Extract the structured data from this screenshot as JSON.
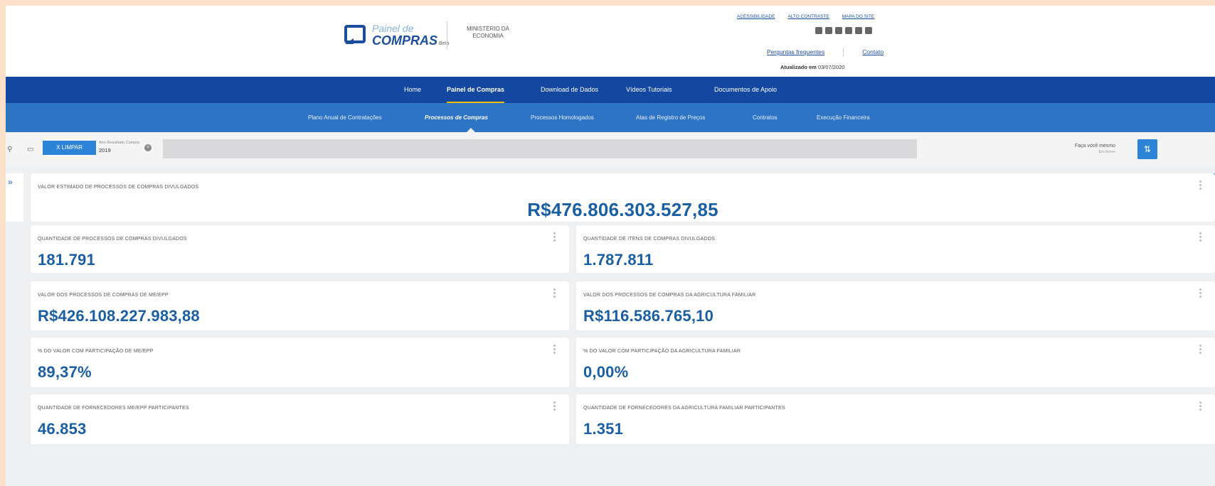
{
  "header": {
    "logo_line1": "Painel de",
    "logo_line2": "COMPRAS",
    "logo_beta": "Beta",
    "ministry_line1": "MINISTÉRIO DA",
    "ministry_line2": "ECONOMIA",
    "util_links": [
      "ACESSIBILIDADE",
      "ALTO CONTRASTE",
      "MAPA DO SITE"
    ],
    "social_icons": [
      "rss-icon",
      "flickr-icon",
      "twitter-icon",
      "facebook-icon",
      "linkedin-icon",
      "youtube-icon"
    ],
    "faq_link": "Perguntas frequentes",
    "contact_link": "Contato",
    "updated_label": "Atualizado em",
    "updated_date": "03/07/2020"
  },
  "main_nav": {
    "items": [
      "Home",
      "Painel de Compras",
      "Download de Dados",
      "Vídeos Tutoriais",
      "Documentos de Apoio"
    ],
    "active": "Painel de Compras"
  },
  "sub_nav": {
    "items": [
      "Plano Anual de Contratações",
      "Processos de Compras",
      "Processos Homologados",
      "Atas de Registro de Preços",
      "Contratos",
      "Execução Financeira"
    ],
    "active": "Processos de Compras"
  },
  "filter_bar": {
    "clear_label": "X  LIMPAR",
    "chip_label": "Ano Resultado Compra",
    "chip_value": "2019",
    "diy_label": "Faça você mesmo",
    "diy_sub": "Em breve"
  },
  "cards": {
    "hero": {
      "title": "VALOR ESTIMADO DE PROCESSOS DE COMPRAS DIVULGADOS",
      "value": "R$476.806.303.527,85"
    },
    "qtd_processos": {
      "title": "QUANTIDADE DE PROCESSOS DE COMPRAS DIVULGADOS",
      "value": "181.791"
    },
    "qtd_itens": {
      "title": "QUANTIDADE DE ITENS DE COMPRAS DIVULGADOS",
      "value": "1.787.811"
    },
    "valor_me_epp": {
      "title": "VALOR DOS PROCESSOS DE COMPRAS DE ME/EPP",
      "value": "R$426.108.227.983,88"
    },
    "valor_agricultura": {
      "title": "VALOR DOS PROCESSOS DE COMPRAS DA AGRICULTURA FAMILIAR",
      "value": "R$116.586.765,10"
    },
    "pct_me_epp": {
      "title": "% DO VALOR COM PARTICIPAÇÃO DE ME/EPP",
      "value": "89,37%"
    },
    "pct_agricultura": {
      "title": "% DO VALOR COM PARTICIPAÇÃO DA AGRICULTURA FAMILIAR",
      "value": "0,00%"
    },
    "fornecedores_me_epp": {
      "title": "QUANTIDADE DE FORNECEDORES ME/EPP PARTICIPANTES",
      "value": "46.853"
    },
    "fornecedores_agricultura": {
      "title": "QUANTIDADE DE FORNECEDORES DA AGRICULTURA FAMILIAR PARTICIPANTES",
      "value": "1.351"
    }
  }
}
